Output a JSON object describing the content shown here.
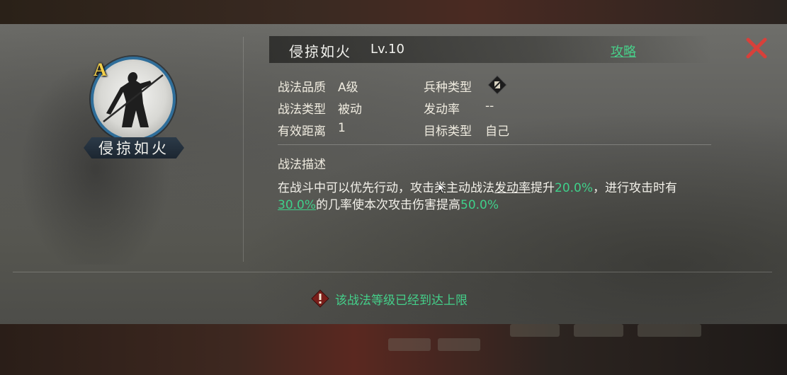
{
  "skill": {
    "grade_badge": "A",
    "emblem_name": "侵掠如火",
    "title": "侵掠如火",
    "level": "Lv.10",
    "guide_label": "攻略"
  },
  "attributes": {
    "quality_label": "战法品质",
    "quality_value": "A级",
    "troop_type_label": "兵种类型",
    "type_label": "战法类型",
    "type_value": "被动",
    "trigger_rate_label": "发动率",
    "trigger_rate_value": "--",
    "range_label": "有效距离",
    "range_value": "1",
    "target_label": "目标类型",
    "target_value": "自己"
  },
  "description": {
    "title": "战法描述",
    "seg1": "在战斗中可以优先行动，攻击类主动战法",
    "seg2": "发动率",
    "seg3": "提升",
    "seg4": "20.0%",
    "seg5": "，进行攻击时有",
    "seg6": "30.0%",
    "seg7": "的几率使本次攻击伤害提高",
    "seg8": "50.0%"
  },
  "notice": {
    "text": "该战法等级已经到达上限"
  },
  "colors": {
    "accent_green": "#3fd08a",
    "close_red": "#d8403a",
    "grade_gold": "#f2cf4a",
    "emblem_ring": "#2f6e9a"
  },
  "icons": {
    "close": "close-x-icon",
    "troop": "troop-type-icon",
    "warning": "warning-icon"
  }
}
